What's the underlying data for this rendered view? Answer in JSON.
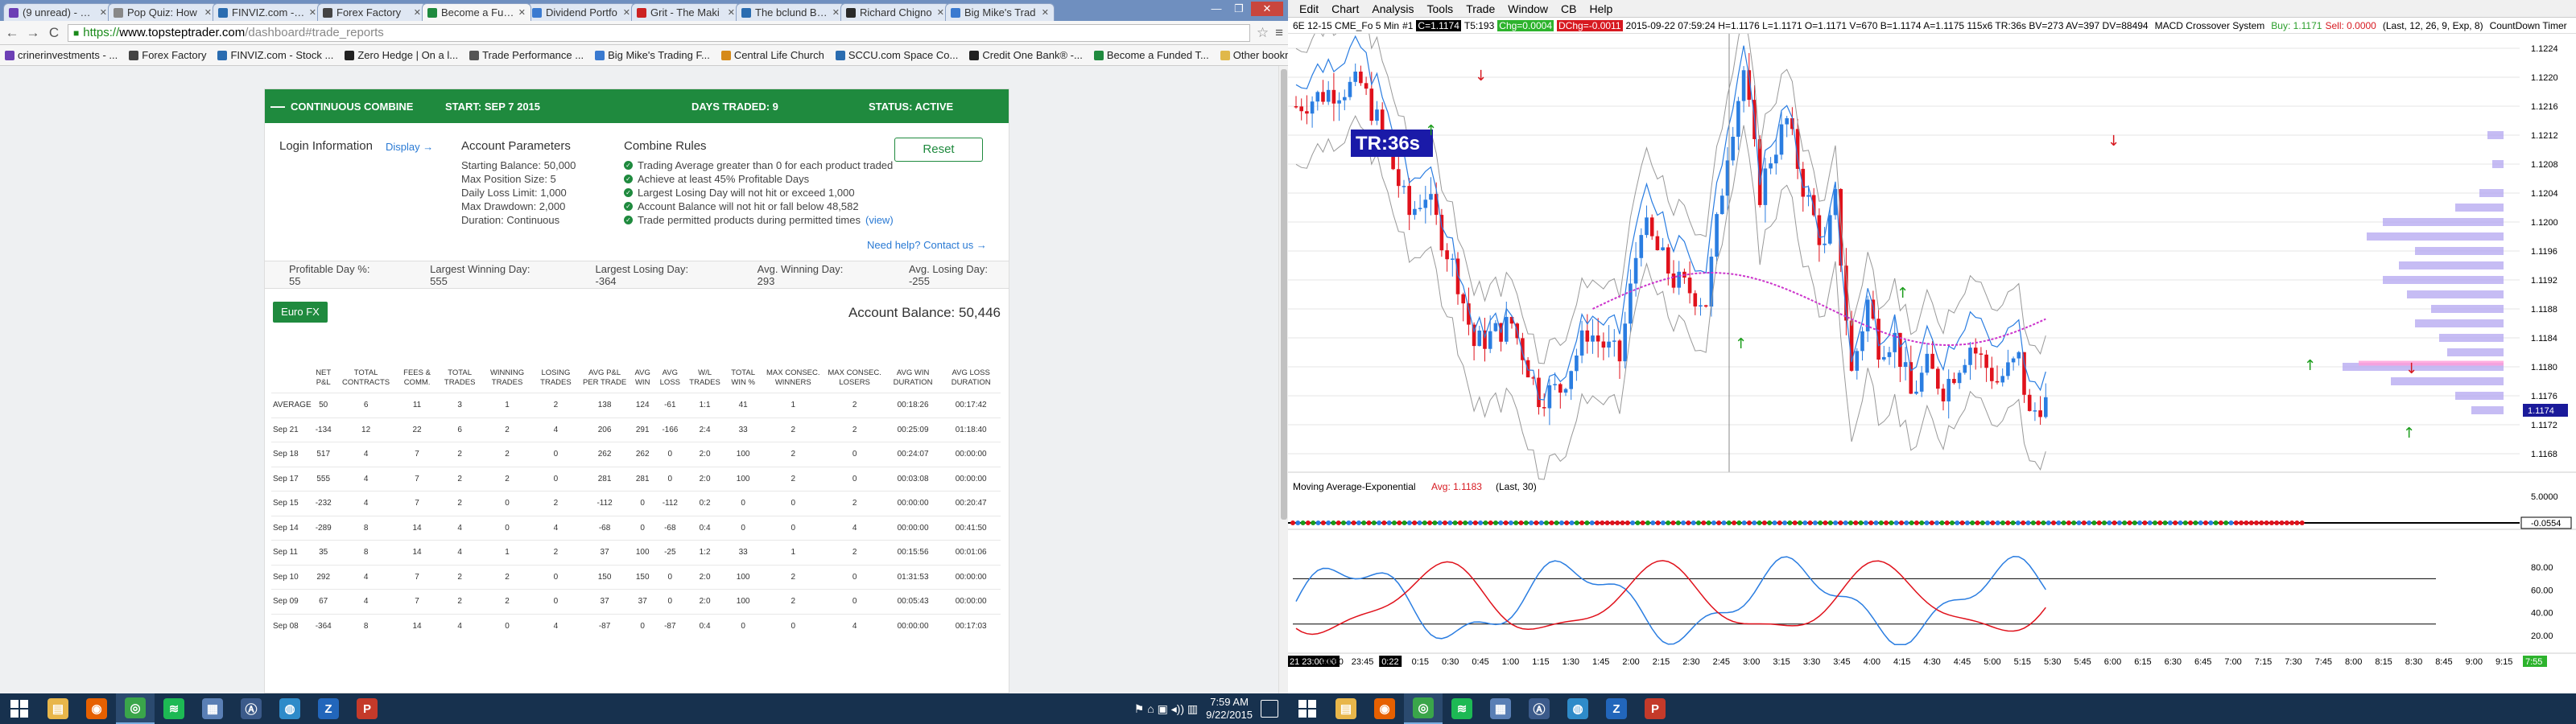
{
  "browser": {
    "tabs": [
      {
        "title": "(9 unread) - crine",
        "color": "#6c3fb5"
      },
      {
        "title": "Pop Quiz: How",
        "color": "#888888"
      },
      {
        "title": "FINVIZ.com - St",
        "color": "#2a6cb0"
      },
      {
        "title": "Forex Factory",
        "color": "#444444"
      },
      {
        "title": "Become a Fund",
        "color": "#1f8a3e",
        "active": true
      },
      {
        "title": "Dividend Portfo",
        "color": "#3a7ad0"
      },
      {
        "title": "Grit - The Maki",
        "color": "#cc2222"
      },
      {
        "title": "The bclund Blog",
        "color": "#2a6cb0"
      },
      {
        "title": "Richard Chigno",
        "color": "#2a2a2a"
      },
      {
        "title": "Big Mike's Trad",
        "color": "#3a7ad0"
      }
    ],
    "window_buttons": {
      "minimize": "—",
      "maximize": "❐",
      "close": "✕"
    },
    "nav": {
      "back": "←",
      "forward": "→",
      "reload": "C"
    },
    "url": {
      "scheme": "https://",
      "host": "www.topsteptrader.com",
      "path": "/dashboard#trade_reports"
    },
    "bookmarks": [
      {
        "label": "crinerinvestments - ...",
        "color": "#6c3fb5"
      },
      {
        "label": "Forex Factory",
        "color": "#444444"
      },
      {
        "label": "FINVIZ.com - Stock ...",
        "color": "#2a6cb0"
      },
      {
        "label": "Zero Hedge | On a l...",
        "color": "#222222"
      },
      {
        "label": "Trade Performance ...",
        "color": "#555555"
      },
      {
        "label": "Big Mike's Trading F...",
        "color": "#3a7ad0"
      },
      {
        "label": "Central Life Church",
        "color": "#d68a1a"
      },
      {
        "label": "SCCU.com Space Co...",
        "color": "#2a6cb0"
      },
      {
        "label": "Credit One Bank® -...",
        "color": "#222222"
      },
      {
        "label": "Become a Funded T...",
        "color": "#1f8a3e"
      }
    ],
    "other_bookmarks": "Other bookmarks"
  },
  "combine": {
    "bar": {
      "title": "CONTINUOUS COMBINE",
      "start": "START: SEP 7 2015",
      "days": "DAYS TRADED: 9",
      "status": "STATUS: ACTIVE"
    },
    "login_info": "Login Information",
    "display_link": "Display →",
    "params_title": "Account Parameters",
    "params": [
      "Starting Balance: 50,000",
      "Max Position Size: 5",
      "Daily Loss Limit: 1,000",
      "Max Drawdown: 2,000",
      "Duration: Continuous"
    ],
    "rules_title": "Combine Rules",
    "rules": [
      "Trading Average greater than 0 for each product traded",
      "Achieve at least 45% Profitable Days",
      "Largest Losing Day will not hit or exceed 1,000",
      "Account Balance will not hit or fall below 48,582",
      "Trade permitted products during permitted times"
    ],
    "rules_view": "(view)",
    "reset": "Reset",
    "help": "Need help? Contact us →",
    "stats": [
      "Profitable Day %: 55",
      "Largest Winning Day: 555",
      "Largest Losing Day: -364",
      "Avg. Winning Day: 293",
      "Avg. Losing Day: -255"
    ],
    "product_button": "Euro FX",
    "account_balance": "Account Balance: 50,446",
    "table": {
      "headers": [
        "",
        "NET P&L",
        "TOTAL CONTRACTS",
        "FEES & COMM.",
        "TOTAL TRADES",
        "WINNING TRADES",
        "LOSING TRADES",
        "AVG P&L PER TRADE",
        "AVG WIN",
        "AVG LOSS",
        "W/L TRADES",
        "TOTAL WIN %",
        "MAX CONSEC. WINNERS",
        "MAX CONSEC. LOSERS",
        "AVG WIN DURATION",
        "AVG LOSS DURATION"
      ],
      "rows": [
        [
          "AVERAGE",
          "50",
          "6",
          "11",
          "3",
          "1",
          "2",
          "138",
          "124",
          "-61",
          "1:1",
          "41",
          "1",
          "2",
          "00:18:26",
          "00:17:42"
        ],
        [
          "Sep 21",
          "-134",
          "12",
          "22",
          "6",
          "2",
          "4",
          "206",
          "291",
          "-166",
          "2:4",
          "33",
          "2",
          "2",
          "00:25:09",
          "01:18:40"
        ],
        [
          "Sep 18",
          "517",
          "4",
          "7",
          "2",
          "2",
          "0",
          "262",
          "262",
          "0",
          "2:0",
          "100",
          "2",
          "0",
          "00:24:07",
          "00:00:00"
        ],
        [
          "Sep 17",
          "555",
          "4",
          "7",
          "2",
          "2",
          "0",
          "281",
          "281",
          "0",
          "2:0",
          "100",
          "2",
          "0",
          "00:03:08",
          "00:00:00"
        ],
        [
          "Sep 15",
          "-232",
          "4",
          "7",
          "2",
          "0",
          "2",
          "-112",
          "0",
          "-112",
          "0:2",
          "0",
          "0",
          "2",
          "00:00:00",
          "00:20:47"
        ],
        [
          "Sep 14",
          "-289",
          "8",
          "14",
          "4",
          "0",
          "4",
          "-68",
          "0",
          "-68",
          "0:4",
          "0",
          "0",
          "4",
          "00:00:00",
          "00:41:50"
        ],
        [
          "Sep 11",
          "35",
          "8",
          "14",
          "4",
          "1",
          "2",
          "37",
          "100",
          "-25",
          "1:2",
          "33",
          "1",
          "2",
          "00:15:56",
          "00:01:06"
        ],
        [
          "Sep 10",
          "292",
          "4",
          "7",
          "2",
          "2",
          "0",
          "150",
          "150",
          "0",
          "2:0",
          "100",
          "2",
          "0",
          "01:31:53",
          "00:00:00"
        ],
        [
          "Sep 09",
          "67",
          "4",
          "7",
          "2",
          "2",
          "0",
          "37",
          "37",
          "0",
          "2:0",
          "100",
          "2",
          "0",
          "00:05:43",
          "00:00:00"
        ],
        [
          "Sep 08",
          "-364",
          "8",
          "14",
          "4",
          "0",
          "4",
          "-87",
          "0",
          "-87",
          "0:4",
          "0",
          "0",
          "4",
          "00:00:00",
          "00:17:03"
        ]
      ]
    }
  },
  "ninja": {
    "menu": [
      "Edit",
      "Chart",
      "Analysis",
      "Tools",
      "Trade",
      "Window",
      "CB",
      "Help"
    ],
    "info": {
      "instrument": "6E 12-15 CME_Fo  5 Min",
      "pos": "#1",
      "c_box": "C=1.1174",
      "ts": "T5:193",
      "chg_up": "Chg=0.0004",
      "chg_dn": "DChg=-0.0011",
      "ohlc": "2015-09-22 07:59:24 H=1.1176 L=1.1171 O=1.1171 V=670 B=1.1174 A=1.1175 115x6 TR:36s BV=273 AV=397 DV=88494",
      "system": "MACD Crossover System",
      "buy": "Buy: 1.1171",
      "sell": "Sell: 0.0000",
      "params": "(Last, 12, 26, 9, Exp, 8)",
      "countdown": "CountDown Timer"
    },
    "tr_label": "TR:36s",
    "ema_label": "Moving Average-Exponential",
    "ema_value": "Avg: 1.1183",
    "ema_params": "(Last, 30)",
    "price_ticks": [
      "1.1224",
      "1.1220",
      "1.1216",
      "1.1212",
      "1.1208",
      "1.1204",
      "1.1200",
      "1.1196",
      "1.1192",
      "1.1188",
      "1.1184",
      "1.1180",
      "1.1176",
      "1.1172",
      "1.1168"
    ],
    "price_marker": "1.1174",
    "ema_axis": [
      "5.0000",
      "0.0000",
      "-0.0554"
    ],
    "osc_axis": [
      "80.00",
      "60.00",
      "40.00",
      "20.00"
    ],
    "time_ticks": [
      "21 23:00:00",
      "23:30",
      "23:45",
      "0:22",
      "0:15",
      "0:30",
      "0:45",
      "1:00",
      "1:15",
      "1:30",
      "1:45",
      "2:00",
      "2:15",
      "2:30",
      "2:45",
      "3:00",
      "3:15",
      "3:30",
      "3:45",
      "4:00",
      "4:15",
      "4:30",
      "4:45",
      "5:00",
      "5:15",
      "5:30",
      "5:45",
      "6:00",
      "6:15",
      "6:30",
      "6:45",
      "7:00",
      "7:15",
      "7:30",
      "7:45",
      "8:00",
      "8:15",
      "8:30",
      "8:45",
      "9:00",
      "9:15",
      "9:30"
    ],
    "time_marker": "7:55",
    "colors": {
      "up": "#2a7de1",
      "down": "#e0111b",
      "ema": "#cc33cc",
      "bands": "#999999",
      "profile": "#b3a6f0"
    }
  },
  "taskbar": {
    "time": "7:59 AM",
    "date": "9/22/2015",
    "left_apps": [
      "file-explorer",
      "firefox",
      "chrome",
      "spotify",
      "photos",
      "tos",
      "globe",
      "zh",
      "pdf"
    ],
    "right_apps": [
      "file-explorer",
      "firefox",
      "chrome",
      "spotify",
      "photos",
      "tos",
      "globe",
      "zh",
      "pdf"
    ]
  }
}
